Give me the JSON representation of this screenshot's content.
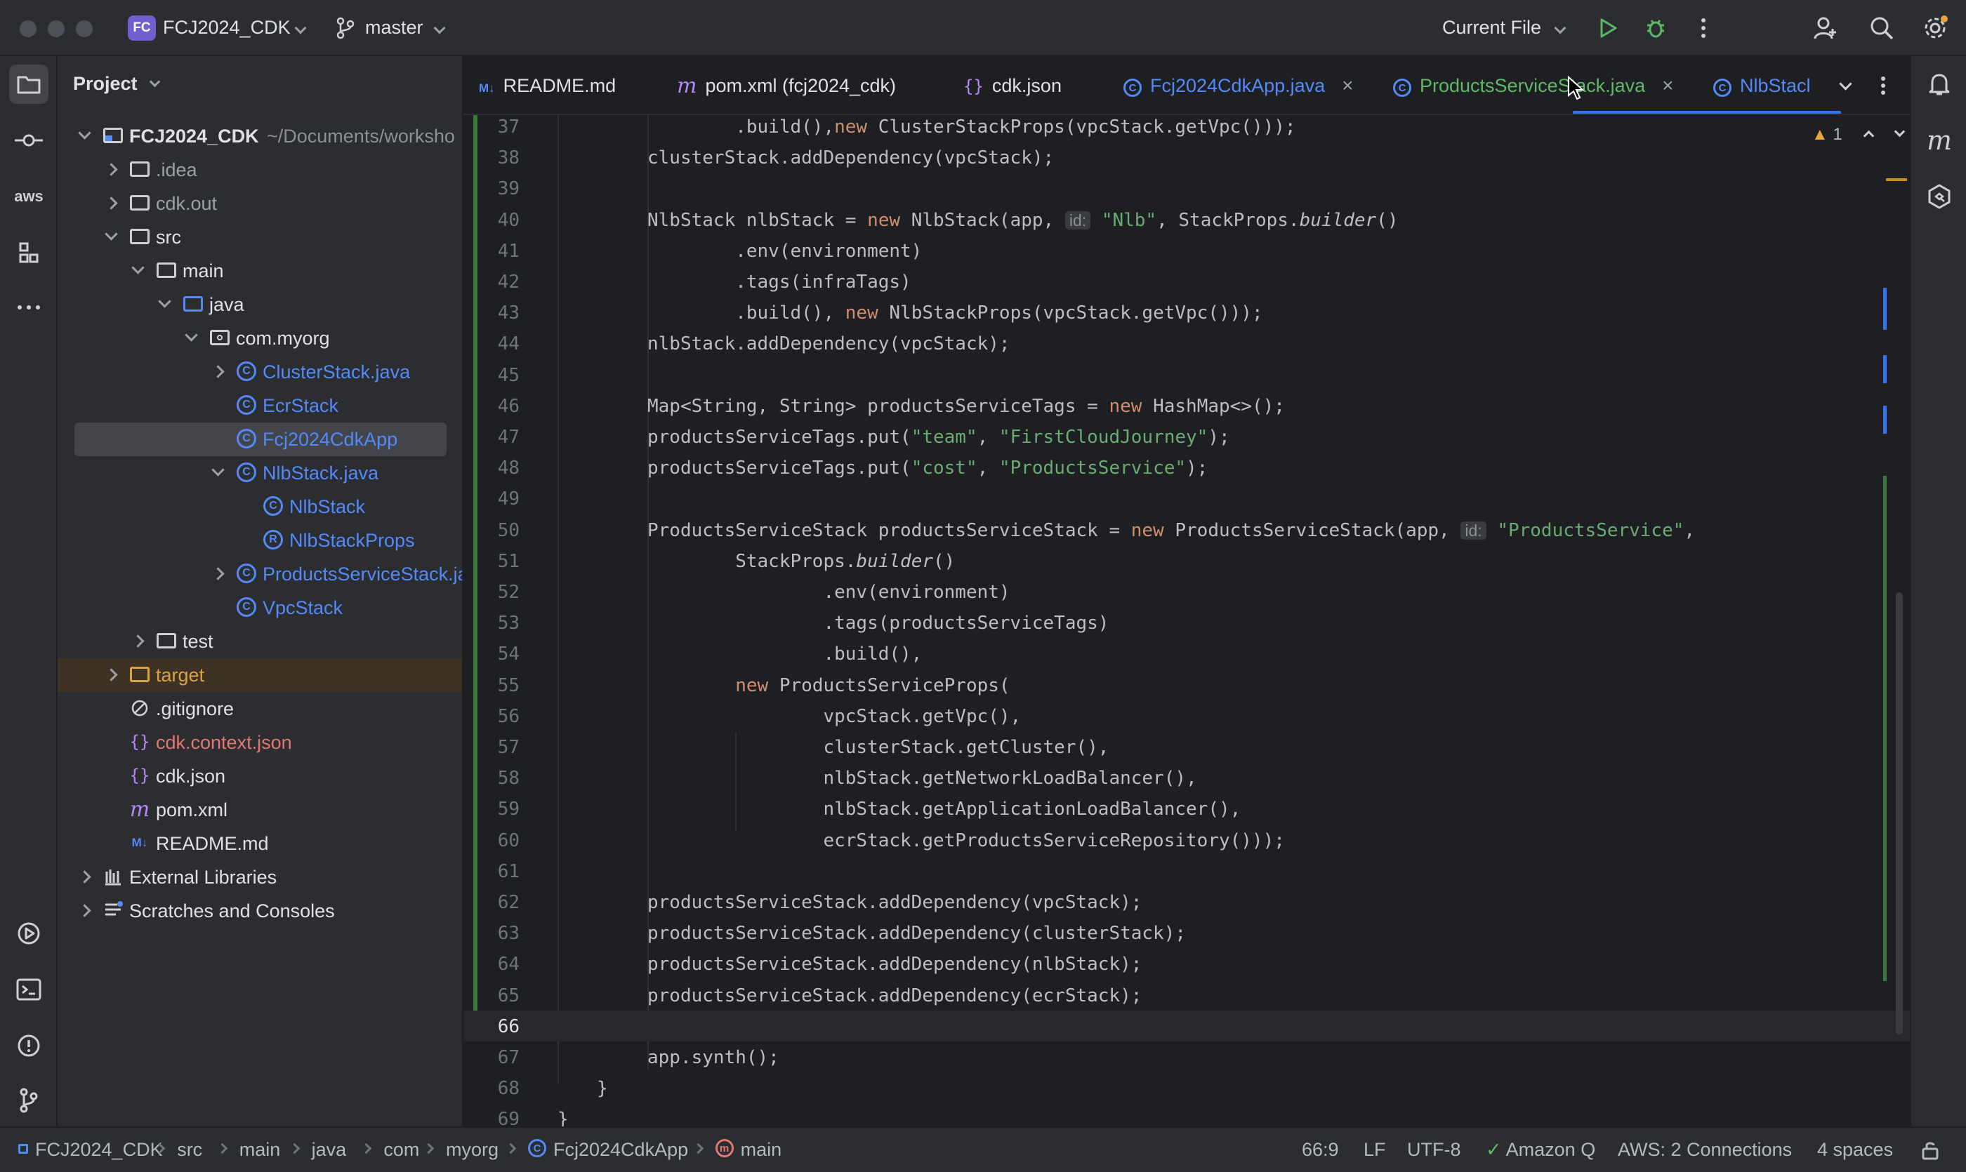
{
  "titlebar": {
    "project_badge": "FC",
    "project_name": "FCJ2024_CDK",
    "branch": "master",
    "run_config": "Current File"
  },
  "project_panel": {
    "title": "Project",
    "tree": [
      {
        "label": "FCJ2024_CDK",
        "extra": "~/Documents/worksho",
        "level": 0,
        "arrow": "down",
        "icon": "module-folder-icon",
        "color": "#dfe1e5"
      },
      {
        "label": ".idea",
        "level": 1,
        "arrow": "right",
        "icon": "folder-icon",
        "color": "#9da0a8"
      },
      {
        "label": "cdk.out",
        "level": 1,
        "arrow": "right",
        "icon": "folder-icon",
        "color": "#9da0a8"
      },
      {
        "label": "src",
        "level": 1,
        "arrow": "down",
        "icon": "folder-icon",
        "color": "#dfe1e5"
      },
      {
        "label": "main",
        "level": 2,
        "arrow": "down",
        "icon": "folder-icon",
        "color": "#dfe1e5"
      },
      {
        "label": "java",
        "level": 3,
        "arrow": "down",
        "icon": "source-folder-icon",
        "color": "#dfe1e5"
      },
      {
        "label": "com.myorg",
        "level": 4,
        "arrow": "down",
        "icon": "package-icon",
        "color": "#dfe1e5"
      },
      {
        "label": "ClusterStack.java",
        "level": 5,
        "arrow": "right",
        "icon": "class-icon",
        "color": "#548af7"
      },
      {
        "label": "EcrStack",
        "level": 5,
        "arrow": "",
        "icon": "class-icon",
        "color": "#548af7"
      },
      {
        "label": "Fcj2024CdkApp",
        "level": 5,
        "arrow": "",
        "icon": "class-icon",
        "color": "#548af7",
        "selected": true
      },
      {
        "label": "NlbStack.java",
        "level": 5,
        "arrow": "down",
        "icon": "class-icon",
        "color": "#548af7"
      },
      {
        "label": "NlbStack",
        "level": 6,
        "arrow": "",
        "icon": "class-icon",
        "color": "#548af7"
      },
      {
        "label": "NlbStackProps",
        "level": 6,
        "arrow": "",
        "icon": "record-icon",
        "color": "#548af7"
      },
      {
        "label": "ProductsServiceStack.ja",
        "level": 5,
        "arrow": "right",
        "icon": "class-icon",
        "color": "#548af7"
      },
      {
        "label": "VpcStack",
        "level": 5,
        "arrow": "",
        "icon": "class-icon",
        "color": "#548af7"
      },
      {
        "label": "test",
        "level": 2,
        "arrow": "right",
        "icon": "folder-icon",
        "color": "#dfe1e5"
      },
      {
        "label": "target",
        "level": 1,
        "arrow": "right",
        "icon": "excluded-folder-icon",
        "color": "#d9a343",
        "excluded": true
      },
      {
        "label": ".gitignore",
        "level": 1,
        "arrow": "",
        "icon": "ignore-file-icon",
        "color": "#dfe1e5"
      },
      {
        "label": "cdk.context.json",
        "level": 1,
        "arrow": "",
        "icon": "json-icon",
        "color": "#e37774"
      },
      {
        "label": "cdk.json",
        "level": 1,
        "arrow": "",
        "icon": "json-icon",
        "color": "#dfe1e5"
      },
      {
        "label": "pom.xml",
        "level": 1,
        "arrow": "",
        "icon": "maven-icon",
        "color": "#dfe1e5"
      },
      {
        "label": "README.md",
        "level": 1,
        "arrow": "",
        "icon": "markdown-icon",
        "color": "#dfe1e5"
      },
      {
        "label": "External Libraries",
        "level": 0,
        "arrow": "right",
        "icon": "library-icon",
        "color": "#dfe1e5"
      },
      {
        "label": "Scratches and Consoles",
        "level": 0,
        "arrow": "right",
        "icon": "scratches-icon",
        "color": "#dfe1e5"
      }
    ]
  },
  "tabs": [
    {
      "label": "README.md",
      "icon": "markdown-icon",
      "color": "#dfe1e5"
    },
    {
      "label": "pom.xml (fcj2024_cdk)",
      "icon": "maven-icon",
      "color": "#dfe1e5"
    },
    {
      "label": "cdk.json",
      "icon": "json-icon",
      "color": "#dfe1e5"
    },
    {
      "label": "Fcj2024CdkApp.java",
      "icon": "class-icon",
      "color": "#548af7",
      "active": true,
      "closable": true
    },
    {
      "label": "ProductsServiceStack.java",
      "icon": "class-icon",
      "color": "#5fb865",
      "closable": true
    },
    {
      "label": "NlbStacl",
      "icon": "class-icon",
      "color": "#548af7"
    }
  ],
  "editor": {
    "warnings": "1",
    "current_line": 66,
    "lines": [
      {
        "n": "37",
        "tokens": [
          [
            "        .build(),",
            ""
          ],
          [
            "new",
            "kw"
          ],
          [
            " ClusterStackProps(vpcStack.getVpc()));",
            ""
          ]
        ]
      },
      {
        "n": "38",
        "tokens": [
          [
            "clusterStack.addDependency(vpcStack);",
            ""
          ]
        ]
      },
      {
        "n": "39",
        "tokens": []
      },
      {
        "n": "40",
        "tokens": [
          [
            "NlbStack nlbStack = ",
            ""
          ],
          [
            "new",
            "kw"
          ],
          [
            " NlbStack(app, ",
            ""
          ],
          [
            "id:",
            "hint"
          ],
          [
            " ",
            ""
          ],
          [
            "\"Nlb\"",
            "str"
          ],
          [
            ", StackProps.",
            ""
          ],
          [
            "builder",
            "it"
          ],
          [
            "()",
            ""
          ]
        ]
      },
      {
        "n": "41",
        "tokens": [
          [
            "        .env(environment)",
            ""
          ]
        ]
      },
      {
        "n": "42",
        "tokens": [
          [
            "        .tags(infraTags)",
            ""
          ]
        ]
      },
      {
        "n": "43",
        "tokens": [
          [
            "        .build(), ",
            ""
          ],
          [
            "new",
            "kw"
          ],
          [
            " NlbStackProps(vpcStack.getVpc()));",
            ""
          ]
        ]
      },
      {
        "n": "44",
        "tokens": [
          [
            "nlbStack.addDependency(vpcStack);",
            ""
          ]
        ]
      },
      {
        "n": "45",
        "tokens": []
      },
      {
        "n": "46",
        "tokens": [
          [
            "Map<String, String> productsServiceTags = ",
            ""
          ],
          [
            "new",
            "kw"
          ],
          [
            " HashMap<>();",
            ""
          ]
        ]
      },
      {
        "n": "47",
        "tokens": [
          [
            "productsServiceTags.put(",
            ""
          ],
          [
            "\"team\"",
            "str"
          ],
          [
            ", ",
            ""
          ],
          [
            "\"FirstCloudJourney\"",
            "str"
          ],
          [
            ");",
            ""
          ]
        ]
      },
      {
        "n": "48",
        "tokens": [
          [
            "productsServiceTags.put(",
            ""
          ],
          [
            "\"cost\"",
            "str"
          ],
          [
            ", ",
            ""
          ],
          [
            "\"ProductsService\"",
            "str"
          ],
          [
            ");",
            ""
          ]
        ]
      },
      {
        "n": "49",
        "tokens": []
      },
      {
        "n": "50",
        "tokens": [
          [
            "ProductsServiceStack productsServiceStack = ",
            ""
          ],
          [
            "new",
            "kw"
          ],
          [
            " ProductsServiceStack(app, ",
            ""
          ],
          [
            "id:",
            "hint"
          ],
          [
            " ",
            ""
          ],
          [
            "\"ProductsService\"",
            "str"
          ],
          [
            ",",
            ""
          ]
        ]
      },
      {
        "n": "51",
        "tokens": [
          [
            "        StackProps.",
            ""
          ],
          [
            "builder",
            "it"
          ],
          [
            "()",
            ""
          ]
        ]
      },
      {
        "n": "52",
        "tokens": [
          [
            "                .env(environment)",
            ""
          ]
        ]
      },
      {
        "n": "53",
        "tokens": [
          [
            "                .tags(productsServiceTags)",
            ""
          ]
        ]
      },
      {
        "n": "54",
        "tokens": [
          [
            "                .build(),",
            ""
          ]
        ]
      },
      {
        "n": "55",
        "tokens": [
          [
            "        ",
            ""
          ],
          [
            "new",
            "kw"
          ],
          [
            " ProductsServiceProps(",
            ""
          ]
        ]
      },
      {
        "n": "56",
        "tokens": [
          [
            "                vpcStack.getVpc(),",
            ""
          ]
        ]
      },
      {
        "n": "57",
        "tokens": [
          [
            "                clusterStack.getCluster(),",
            ""
          ]
        ]
      },
      {
        "n": "58",
        "tokens": [
          [
            "                nlbStack.getNetworkLoadBalancer(),",
            ""
          ]
        ]
      },
      {
        "n": "59",
        "tokens": [
          [
            "                nlbStack.getApplicationLoadBalancer(),",
            ""
          ]
        ]
      },
      {
        "n": "60",
        "tokens": [
          [
            "                ecrStack.getProductsServiceRepository()));",
            ""
          ]
        ]
      },
      {
        "n": "61",
        "tokens": []
      },
      {
        "n": "62",
        "tokens": [
          [
            "productsServiceStack.addDependency(vpcStack);",
            ""
          ]
        ]
      },
      {
        "n": "63",
        "tokens": [
          [
            "productsServiceStack.addDependency(clusterStack);",
            ""
          ]
        ]
      },
      {
        "n": "64",
        "tokens": [
          [
            "productsServiceStack.addDependency(nlbStack);",
            ""
          ]
        ]
      },
      {
        "n": "65",
        "tokens": [
          [
            "productsServiceStack.addDependency(ecrStack);",
            ""
          ]
        ]
      },
      {
        "n": "66",
        "tokens": []
      },
      {
        "n": "67",
        "tokens": [
          [
            "app.synth();",
            ""
          ]
        ]
      },
      {
        "n": "68",
        "tokens": [
          [
            "}",
            "dedent1"
          ]
        ]
      },
      {
        "n": "69",
        "tokens": [
          [
            "}",
            "dedent2"
          ]
        ]
      }
    ]
  },
  "statusbar": {
    "breadcrumbs": [
      "FCJ2024_CDK",
      "src",
      "main",
      "java",
      "com",
      "myorg",
      "Fcj2024CdkApp",
      "main"
    ],
    "position": "66:9",
    "line_sep": "LF",
    "encoding": "UTF-8",
    "amazon_q": "Amazon Q",
    "aws": "AWS: 2 Connections",
    "indent": "4 spaces"
  }
}
